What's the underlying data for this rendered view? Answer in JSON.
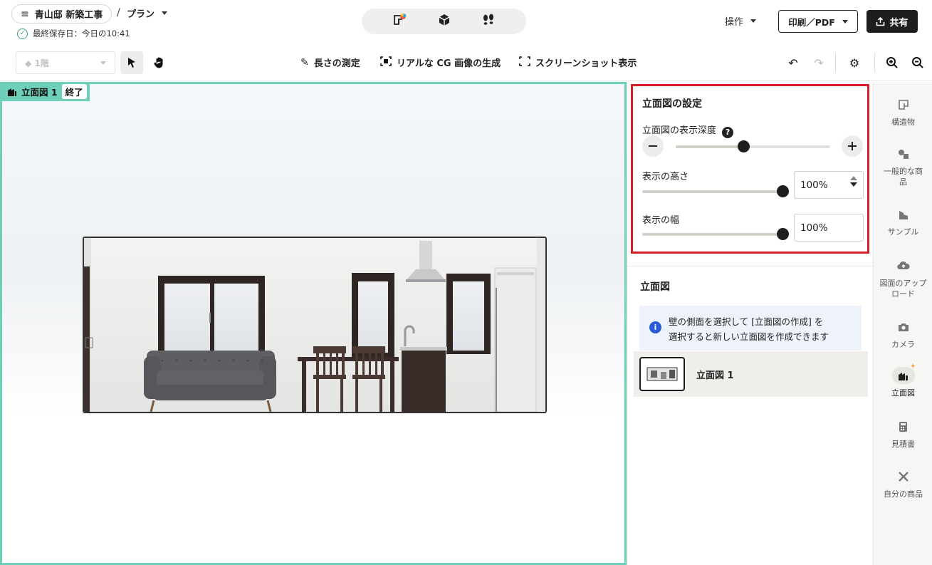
{
  "header": {
    "project_name": "青山邸 新築工事",
    "separator": "/",
    "plan_label": "プラン",
    "save_status": "最終保存日：今日の10:41",
    "operations_label": "操作",
    "print_label": "印刷／PDF",
    "share_label": "共有"
  },
  "toolbar": {
    "floor_value": "1階",
    "measure_label": "長さの測定",
    "cg_label": "リアルな CG 画像の生成",
    "screenshot_label": "スクリーンショット表示"
  },
  "canvas": {
    "tag_label": "立面図 1",
    "end_label": "終了"
  },
  "settings": {
    "title": "立面図の設定",
    "depth_label": "立面図の表示深度",
    "depth_level": 0.44,
    "height_label": "表示の高さ",
    "height_value": "100%",
    "height_level": 1.0,
    "width_label": "表示の幅",
    "width_value": "100%",
    "width_level": 1.0
  },
  "elevations": {
    "title": "立面図",
    "info_line1": "壁の側面を選択して [立面図の作成] を",
    "info_line2": "選択すると新しい立面図を作成できます",
    "items": [
      {
        "label": "立面図 1"
      }
    ]
  },
  "rail": {
    "items": [
      {
        "label": "構造物"
      },
      {
        "label": "一般的な商品"
      },
      {
        "label": "サンプル"
      },
      {
        "label": "図面のアップロード"
      },
      {
        "label": "カメラ"
      },
      {
        "label": "立面図"
      },
      {
        "label": "見積書"
      },
      {
        "label": "自分の商品"
      }
    ]
  },
  "colors": {
    "canvas_border": "#6ed0b8",
    "highlight_border": "#d61f26",
    "info_accent": "#2a5bd7"
  }
}
